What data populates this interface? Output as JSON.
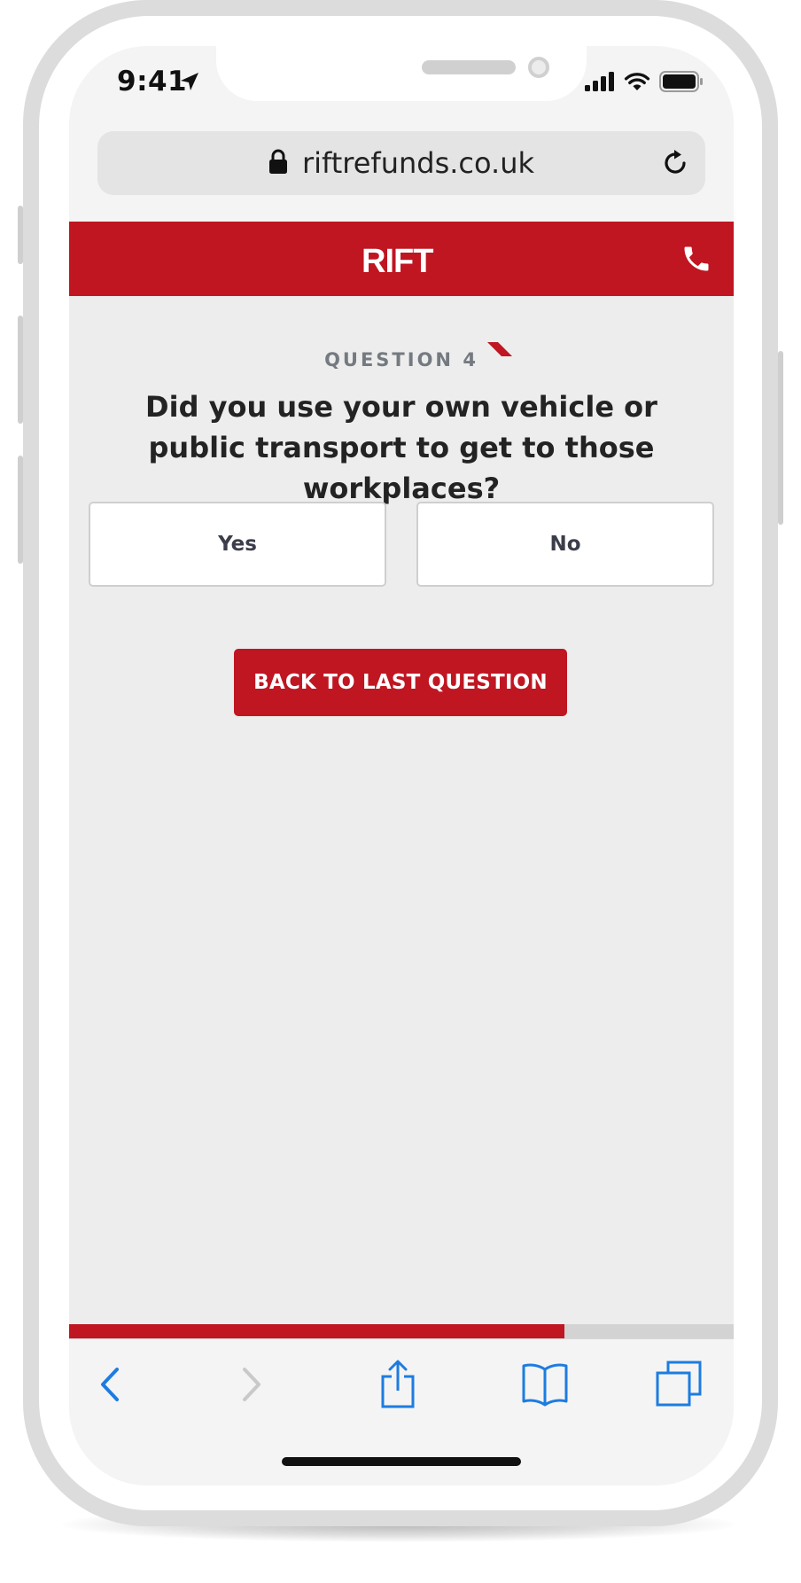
{
  "status_bar": {
    "time": "9:41",
    "icons": [
      "location-arrow-icon",
      "signal-icon",
      "wifi-icon",
      "battery-icon"
    ]
  },
  "browser": {
    "url": "riftrefunds.co.uk",
    "icons": [
      "lock-icon",
      "reload-icon"
    ]
  },
  "header": {
    "logo_text": "RIFT",
    "icons": [
      "phone-icon"
    ]
  },
  "question": {
    "label": "QUESTION 4",
    "text": "Did you use your own vehicle or public transport to get to those workplaces?",
    "options": [
      "Yes",
      "No"
    ]
  },
  "back_button": {
    "label": "BACK TO LAST QUESTION"
  },
  "progress": {
    "fraction": 0.745
  },
  "toolbar": {
    "icons": [
      "back-arrow-icon",
      "forward-arrow-icon",
      "share-icon",
      "bookmarks-icon",
      "tabs-icon"
    ]
  },
  "colors": {
    "brand_red": "#bf1622",
    "content_bg": "#ededed",
    "ios_blue": "#1d7ce0"
  }
}
